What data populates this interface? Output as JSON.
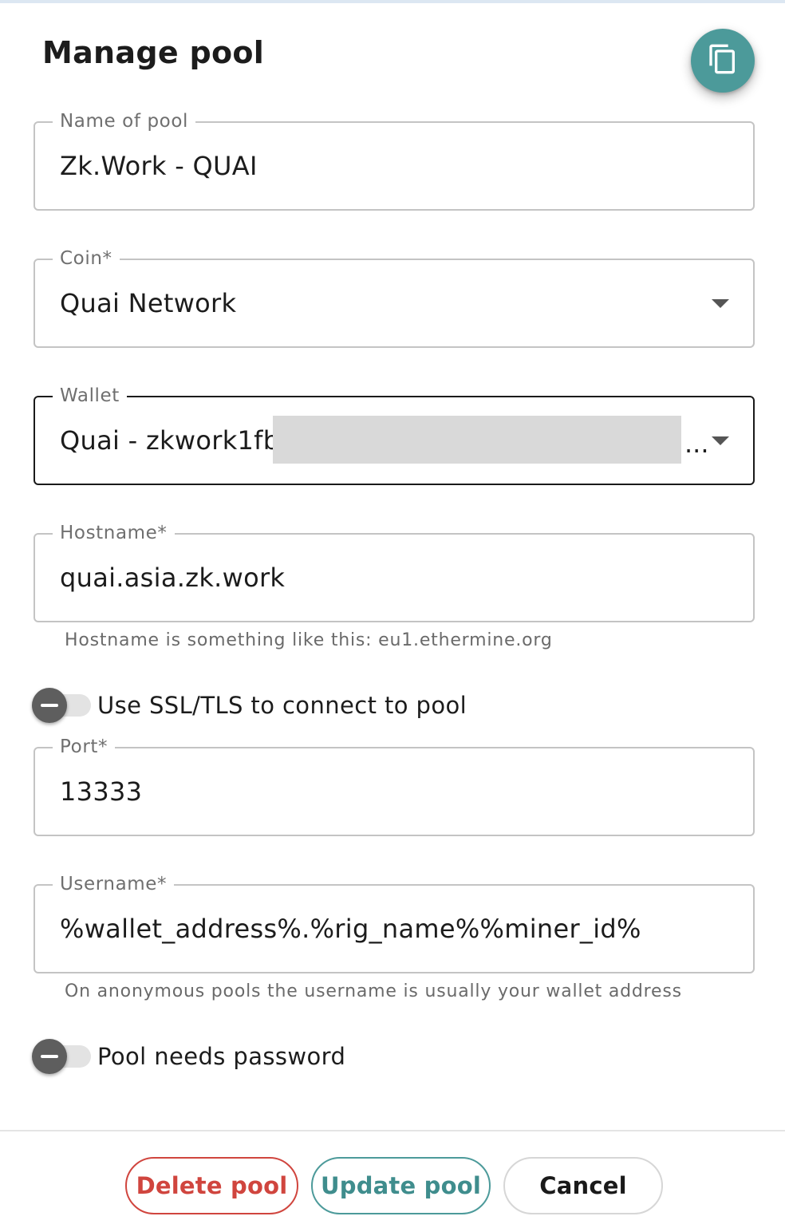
{
  "dialog": {
    "title": "Manage pool"
  },
  "fields": {
    "name": {
      "label": "Name of pool",
      "value": "Zk.Work - QUAI"
    },
    "coin": {
      "label": "Coin*",
      "value": "Quai Network"
    },
    "wallet": {
      "label": "Wallet",
      "value_visible": "Quai - zkwork1fb4",
      "truncation": "..."
    },
    "hostname": {
      "label": "Hostname*",
      "value": "quai.asia.zk.work",
      "helper": "Hostname is something like this: eu1.ethermine.org"
    },
    "ssl_toggle": {
      "label": "Use SSL/TLS to connect to pool",
      "checked": false
    },
    "port": {
      "label": "Port*",
      "value": "13333"
    },
    "username": {
      "label": "Username*",
      "value": "%wallet_address%.%rig_name%%miner_id%",
      "helper": "On anonymous pools the username is usually your wallet address"
    },
    "password_toggle": {
      "label": "Pool needs password",
      "checked": false
    }
  },
  "buttons": {
    "delete": "Delete pool",
    "update": "Update pool",
    "cancel": "Cancel"
  },
  "colors": {
    "accent": "#4c9a9a",
    "danger": "#d0453e",
    "toggle_off": "#5e5e5e"
  },
  "icons": {
    "copy": "copy-icon",
    "coin_dropdown": "chevron-down-icon",
    "wallet_dropdown": "chevron-down-icon",
    "toggle_minus": "minus-icon"
  }
}
